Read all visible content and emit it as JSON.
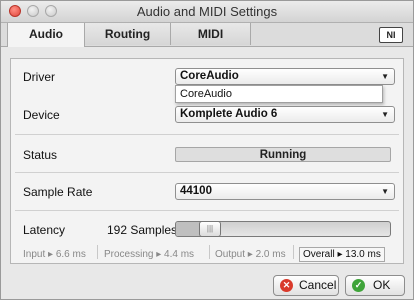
{
  "window": {
    "title": "Audio and MIDI Settings"
  },
  "tabs": [
    {
      "label": "Audio"
    },
    {
      "label": "Routing"
    },
    {
      "label": "MIDI"
    }
  ],
  "logo": {
    "text": "NI"
  },
  "driver": {
    "label": "Driver",
    "value": "CoreAudio",
    "options": [
      "CoreAudio"
    ]
  },
  "device": {
    "label": "Device",
    "value": "Komplete Audio 6"
  },
  "status": {
    "label": "Status",
    "value": "Running"
  },
  "sample_rate": {
    "label": "Sample Rate",
    "value": "44100"
  },
  "latency": {
    "label": "Latency",
    "value": "192 Samples",
    "slider_fraction": 0.12,
    "input": "Input ▸ 6.6 ms",
    "processing": "Processing ▸ 4.4 ms",
    "output": "Output ▸ 2.0 ms",
    "overall": "Overall ▸ 13.0 ms"
  },
  "buttons": {
    "cancel": "Cancel",
    "ok": "OK"
  },
  "colors": {
    "cancel_icon": "#d93a2b",
    "ok_icon": "#3fa43a"
  },
  "icons": {
    "dropdown": "▼",
    "cancel": "✕",
    "ok": "✓",
    "grip": "|||"
  }
}
